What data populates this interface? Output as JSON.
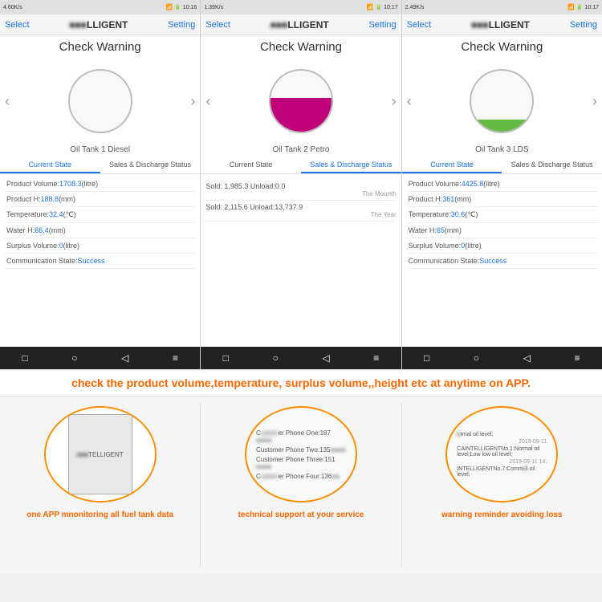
{
  "phones": [
    {
      "id": "phone1",
      "status_bar": "4.60K/s  📶 4G  🔋 10:16",
      "nav": {
        "select": "Select",
        "title": "TELLIGENT",
        "setting": "Setting"
      },
      "title": "Check Warning",
      "tank_name": "Oil Tank 1 Diesel",
      "tank_fill_color": "#f0f0f0",
      "tank_fill_height": "0%",
      "tabs": [
        "Current State",
        "Sales & Discharge Status"
      ],
      "active_tab": 0,
      "view": "current",
      "data": [
        {
          "label": "Product Volume:",
          "value": "1708.3",
          "unit": "(litre)"
        },
        {
          "label": "Product H:",
          "value": "188.8",
          "unit": "(mm)"
        },
        {
          "label": "Temperature:",
          "value": "32.4",
          "unit": "(℃)"
        },
        {
          "label": "Water H:",
          "value": "66.4",
          "unit": "(mm)"
        },
        {
          "label": "Surplus Volume:",
          "value": "0",
          "unit": "(litre)"
        },
        {
          "label": "Communication State:",
          "value": "Success",
          "unit": ""
        }
      ]
    },
    {
      "id": "phone2",
      "status_bar": "1.39K/s  📶 4G  🔋 10:17",
      "nav": {
        "select": "Select",
        "title": "TELLIGENT",
        "setting": "Setting"
      },
      "title": "Check Warning",
      "tank_name": "Oil Tank 2 Petro",
      "tank_fill_color": "#c0007a",
      "tank_fill_height": "55%",
      "tabs": [
        "Current State",
        "Sales & Discharge Status"
      ],
      "active_tab": 1,
      "view": "sales",
      "sales": [
        {
          "label": "Sold: 1,985.3 Unload:0.0",
          "period": "The Mounth"
        },
        {
          "label": "Sold: 2,115.6 Unload:13,737.9",
          "period": "The Year"
        }
      ]
    },
    {
      "id": "phone3",
      "status_bar": "2.49K/s  📶 4G  🔋 10:17",
      "nav": {
        "select": "Select",
        "title": "TELLIGENT",
        "setting": "Setting"
      },
      "title": "Check Warning",
      "tank_name": "Oil Tank 3 LDS",
      "tank_fill_color": "#66bb44",
      "tank_fill_height": "20%",
      "tabs": [
        "Current State",
        "Sales & Discharge Status"
      ],
      "active_tab": 0,
      "view": "current",
      "data": [
        {
          "label": "Product Volume:",
          "value": "4425.8",
          "unit": "(litre)"
        },
        {
          "label": "Product H:",
          "value": "361",
          "unit": "(mm)"
        },
        {
          "label": "Temperature:",
          "value": "30.6",
          "unit": "(℃)"
        },
        {
          "label": "Water H:",
          "value": "65",
          "unit": "(mm)"
        },
        {
          "label": "Surplus Volume:",
          "value": "0",
          "unit": "(litre)"
        },
        {
          "label": "Communication State:",
          "value": "Success",
          "unit": ""
        }
      ]
    }
  ],
  "middle_text": "check the product volume,temperature, surplus volume,,height etc at anytime on APP.",
  "bottom_cards": [
    {
      "id": "card1",
      "oval_type": "phone",
      "screen_text": "TELLIGENT",
      "label": "one APP mnonitoring all fuel tank data"
    },
    {
      "id": "card2",
      "oval_type": "contacts",
      "contacts": [
        "Customer Phone One:187●●●●",
        "Customer Phone Two:135●●●●",
        "Customer Phone Three:151●●●●",
        "Customer Phone Four:136●●●●"
      ],
      "label": "technical support at your service"
    },
    {
      "id": "card3",
      "oval_type": "notifications",
      "notifications": [
        "Normal oil level;",
        "2019-09-11",
        "CAINTELLIGENTNo.1:Normal oil level;Low low oil level;",
        "2019-09-11 14:",
        "INTELLIGENTNo.7:Comm oil level;"
      ],
      "label": "warning reminder avoiding loss"
    }
  ],
  "android_buttons": [
    "□",
    "○",
    "◁",
    "≡"
  ]
}
